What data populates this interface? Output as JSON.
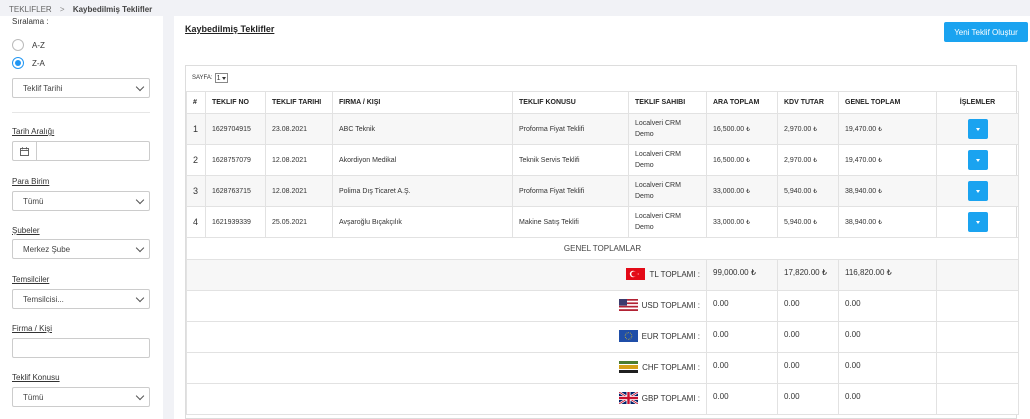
{
  "breadcrumb": {
    "parent": "TEKLIFLER",
    "separator": ">",
    "current": "Kaybedilmiş Teklifler"
  },
  "sidebar": {
    "sort_label": "Sıralama :",
    "sort_options": [
      "A-Z",
      "Z-A"
    ],
    "sort_selected": "Z-A",
    "sort_field": "Teklif Tarihi",
    "date_range_label": "Tarih Aralığı",
    "currency_label": "Para Birim",
    "currency_value": "Tümü",
    "branches_label": "Şubeler",
    "branches_value": "Merkez Şube",
    "reps_label": "Temsilciler",
    "reps_value": "Temsilcisi...",
    "company_label": "Firma / Kişi",
    "topic_label": "Teklif Konusu",
    "topic_value": "Tümü"
  },
  "main": {
    "title": "Kaybedilmiş Teklifler",
    "new_button": "Yeni Teklif Oluştur",
    "page_label": "SAYFA:",
    "page_value": "1"
  },
  "table": {
    "headers": [
      "#",
      "TEKLIF NO",
      "TEKLIF TARIHI",
      "FIRMA / KIŞI",
      "TEKLIF KONUSU",
      "TEKLIF SAHIBI",
      "ARA TOPLAM",
      "KDV TUTAR",
      "GENEL TOPLAM",
      "İŞLEMLER"
    ],
    "rows": [
      {
        "n": "1",
        "no": "1629704915",
        "date": "23.08.2021",
        "company": "ABC Teknik",
        "topic": "Proforma Fiyat Teklifi",
        "owner1": "Localveri CRM",
        "owner2": "Demo",
        "sub": "16,500.00",
        "vat": "2,970.00",
        "total": "19,470.00"
      },
      {
        "n": "2",
        "no": "1628757079",
        "date": "12.08.2021",
        "company": "Akordiyon Medikal",
        "topic": "Teknik Servis Teklifi",
        "owner1": "Localveri CRM",
        "owner2": "Demo",
        "sub": "16,500.00",
        "vat": "2,970.00",
        "total": "19,470.00"
      },
      {
        "n": "3",
        "no": "1628763715",
        "date": "12.08.2021",
        "company": "Polima Dış Ticaret A.Ş.",
        "topic": "Proforma Fiyat Teklifi",
        "owner1": "Localveri CRM",
        "owner2": "Demo",
        "sub": "33,000.00",
        "vat": "5,940.00",
        "total": "38,940.00"
      },
      {
        "n": "4",
        "no": "1621939339",
        "date": "25.05.2021",
        "company": "Avşaroğlu Bıçakçılık",
        "topic": "Makine Satış Teklifi",
        "owner1": "Localveri CRM",
        "owner2": "Demo",
        "sub": "33,000.00",
        "vat": "5,940.00",
        "total": "38,940.00"
      }
    ],
    "currency_symbol": "₺"
  },
  "totals": {
    "title": "GENEL TOPLAMLAR",
    "rows": [
      {
        "label": "TL TOPLAMI :",
        "flag": "turkey-flag",
        "sub": "99,000.00 ₺",
        "vat": "17,820.00 ₺",
        "total": "116,820.00 ₺"
      },
      {
        "label": "USD TOPLAMI :",
        "flag": "usa-flag",
        "sub": "0.00",
        "vat": "0.00",
        "total": "0.00"
      },
      {
        "label": "EUR TOPLAMI :",
        "flag": "eu-flag",
        "sub": "0.00",
        "vat": "0.00",
        "total": "0.00"
      },
      {
        "label": "CHF TOPLAMI :",
        "flag": "chf-flag",
        "sub": "0.00",
        "vat": "0.00",
        "total": "0.00"
      },
      {
        "label": "GBP TOPLAMI :",
        "flag": "uk-flag",
        "sub": "0.00",
        "vat": "0.00",
        "total": "0.00"
      }
    ]
  },
  "colors": {
    "accent": "#1aa3f0",
    "radio": "#2196f3"
  }
}
